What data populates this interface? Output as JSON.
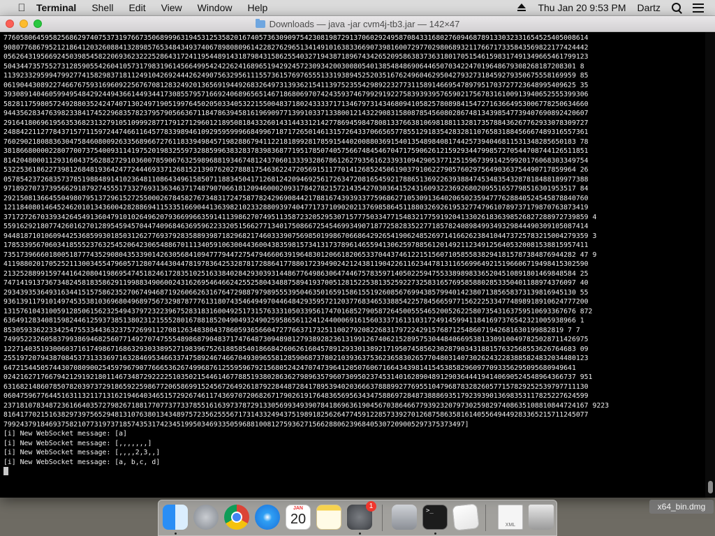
{
  "menubar": {
    "apple_icon": "apple-icon",
    "app_name": "Terminal",
    "menus": [
      "Shell",
      "Edit",
      "View",
      "Window",
      "Help"
    ],
    "clock": "Thu Jan 20  9:53 PM",
    "user": "Dartz"
  },
  "window": {
    "title": "Downloads — java -jar cvm4j-tb3.jar — 142×47",
    "colors": {
      "background": "#000000",
      "text": "#f0f0f0"
    }
  },
  "terminal": {
    "lines": [
      "7760580645958256862974075373197667350689996319453125358201674057363090975423081987291370602924958708433168027609468789133032331654525405008614",
      "9080776867952121864120326088413289857653484349374067898080961422827629651341491016383366907398160072977029806893211766717335843569822177424442",
      "0562643195669245039854582206936232225286431724119544891431879843158625540327194387189674342652095863837363180170515461598317491349665461799123",
      "5043447357552731285905542604105731798319614566499542422624168965194292457230934200300805401385484869064465070342247019648679308268187208301 8",
      "1139233295994799277415829837181124910426924442624907563295611155736157697655513319389452520351676249604629504279327318459279350675558169959 85",
      "0619044308922746676759316960922567670812832492013656919449268326497313936215411397523554298922327731158914669547897951703727723648995409625 35",
      "3930891404605994954842924494366144934417308557957166924068965651467186806970742435937467992919227583939395765902175678316100913940652555399306",
      "5828117598057249288035242474071302497190519976450205033405322155004837180243333717134679731434680941058257808984154727163664953006778250634660",
      "9443562834763982338417452296835782379579056636711847863945816196909771399103371338001214322908315808785456080286748134398547739407690892420607",
      "2916418069619563536823132791051099928771791271296012189508184332601431443312142778694598478081337663810698188113281735788436267762933078309727",
      "2488422112778437157711597244746611645778339894610929595999668499671871726501461315726433706656577855129183542832811076583188456667489316557361",
      "7602902180883630475846080092633568966727611833949845719828867941122181899281785915440200880369154013548984081744257394046811531348285650183 78",
      "3818668000022807700737540093114197520198325597328859963832837839836877195178507405756674845467047175906261215929344799857270544708744126511851",
      "8142048000112931604375628827291036007859067632598968819346748124370601333932867861262793561623393109429053771251596739914259920176068303349754",
      "5322536186227398126848193642477244469337126815213907620278881754636224720569151177014126852450619037910622790576029756490363754490717859964 26",
      "0578542372683573785198848914102364811086434961585071188345041712681242094692561726347208165459217886513692263938847453483543287818488189977388",
      "9718927073739566291879274555173327693136346371748790706618120946000209317842782157214354270303641524316093223692680209551657798516301953517 84",
      "2921508136645504980795137296152725500026784582767348317247587782429690844217881674393933775968627105309136402065023594777628840524545878840760",
      "1211840801464524620101343600428288694115335166904413639821023328809397404771737109020213769858645118803269261953277479610789737179870763873419",
      "3717272670339342645491360479101026496207936699663591411398627074951135872320529530715777503347715483217759192041330261836398526827288972739859 4",
      "5591629218077426016270128954594570447409684636959622332051566277134017508667254546993490718772582835227718578240898499349329844490309105087414",
      "9448187101060944253685993018503126277693792835889398718296821746033390756985019986706686429265419062485269714166262384104473725783215004279359 3",
      "1785339567060341855523763254520642306548867011134059106300443600438359815734131737896146559413062597885612014921123491256405320081538815957411",
      "7351739666018005187774352908043533901426305684109477794472754794660639196483012066182065337044374612215156071058558382941815787384876944282 47 9",
      "4119880201705252113003455479605712807444304478197836425328781728864177880172394902421243811904226116234478131165699649215196606719498415302590",
      "2132528899159744164208041986954745182461728351025163384028429303931448677649863064744675783597140502259475533898983365204510891801469848584 25",
      "7471419137367348245818358629119988349060024316269546466242552580434887589419370051281522538135259227325831657695858802853350401188974376097 40",
      "2934393536493163441515758623527067494687192606626316764729887979895553950463501659158615519260856769943857994014238071385658373139816945130 55",
      "9361391179101497453538103696804968975673298787776131807435464949704464842935957212037768346533885422578456659771562225334774898918910624777200",
      "1315761043100591285061562325494379723223967528318316004925173157633310503395617470168527905872645005554652005262258073543163759510693367676 872",
      "6364912834081598244612593738513802312155528016788185204904932490259586561124124400069161560333716131031724914599411841697376542321005938966 1",
      "8530593362233425475533443632375726991127081263483804378605936566047277663717325110027920822683179722429157687125486071942681630199882819 7 7",
      "7499522326058379938694682560771492707475554898687904837174764873094898127938928236131991267406215289575304484066953813309100497825028711426975",
      "1227140351930060371617498671686329303389527198396752618858540186684260626160457891293301389217195074585623028790343188157632568553626764683 09",
      "2551972079438708453731333697163284695346633747589246746670493096558128590687378021039363753623658302657704803140730262432283885824832034480123",
      "6472154450574430708090025459796790776665362674996876125595967921568052424707473964120507606716643439814154538582960977093356295095680949641",
      "0242162717667942129192180114673487292222510350215446146778851938028636279896357960730950237453140162890489129036444194140690524548964366737 951",
      "6316821486078507820397372918659225986772065869915245672649261879228448728417895394020366637888992776955104796878328260577157829252539797711130",
      "0604759677644516311321171316219464034651572926746117436970720682671790261917648365695634347588697284873888693517923939013698353117825227624599",
      "2371810783487236166403572798267188177077377337855161639737872913305699349390784186963619045670386466779392320797302598297408635108810844724167 9223",
      "8164177021516382973975652948131076380134348975723562555671731433249437519891825626477459122857339270126875863581614055649449283365215711245077",
      "7992437918469375821077319737185743531742345199503469335059688100812759362715662880623968405307209005297375373497]",
      "[i] New WebSocket message: [a]",
      "[i] New WebSocket message: [,,,,,,,]",
      "[i] New WebSocket message: [,,,,2,3,,]",
      "[i] New WebSocket message: [a, b,c, d]"
    ]
  },
  "dock": {
    "items": [
      {
        "name": "finder-icon"
      },
      {
        "name": "launchpad-icon"
      },
      {
        "name": "chrome-icon"
      },
      {
        "name": "safari-icon"
      },
      {
        "name": "calendar-icon",
        "month": "JAN",
        "day": "20"
      },
      {
        "name": "notes-icon"
      },
      {
        "name": "system-preferences-icon",
        "badge": "1"
      },
      {
        "name": "archive-utility-icon"
      },
      {
        "name": "terminal-icon",
        "glyph": ">_"
      },
      {
        "name": "textedit-icon"
      },
      {
        "name": "xml-file-icon",
        "label": "XML"
      },
      {
        "name": "trash-icon"
      }
    ]
  },
  "desktop": {
    "file_label": "x64_bin.dmg"
  }
}
